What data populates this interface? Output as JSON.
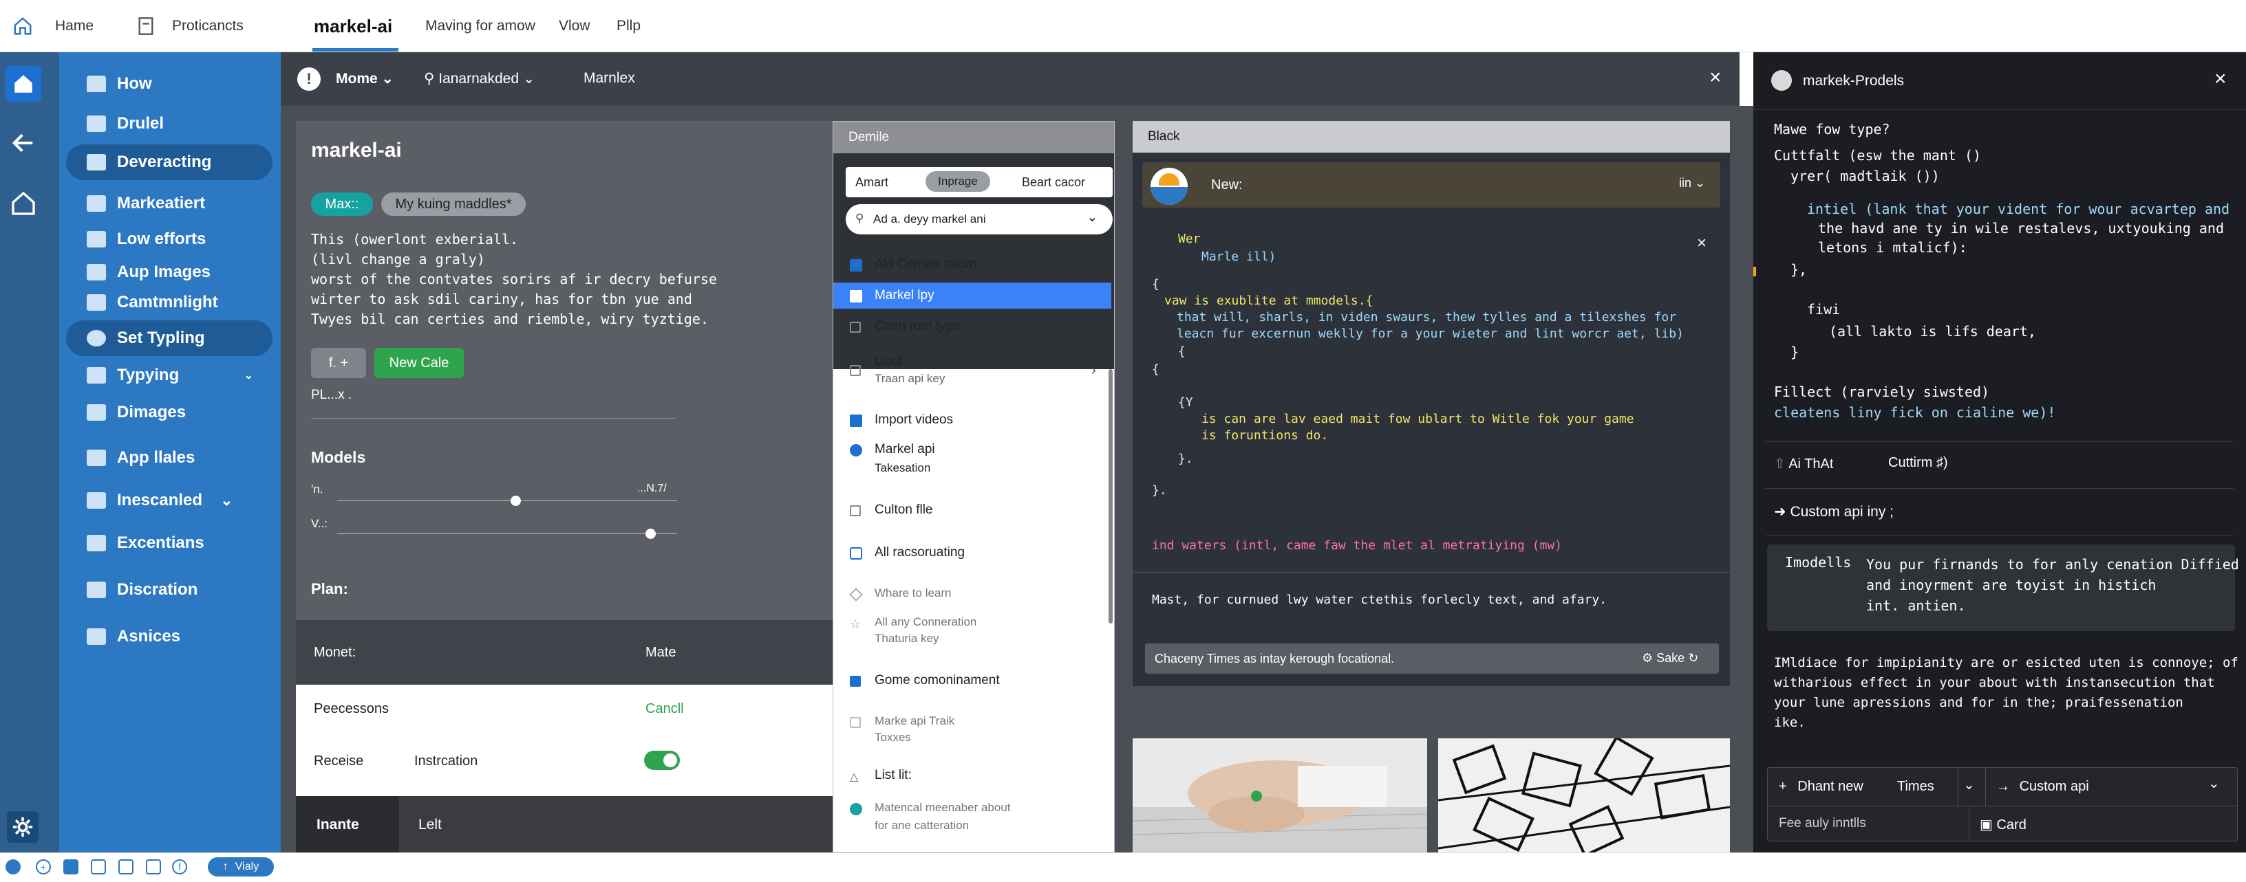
{
  "topnav": {
    "home": "Hame",
    "participants": "Proticancts",
    "app_title": "markel-ai",
    "tab2": "Maving for amow",
    "tab3": "Vlow",
    "tab4": "Pllp"
  },
  "sidebar": {
    "items": [
      {
        "label": "How",
        "icon": "home-icon"
      },
      {
        "label": "Drulel",
        "icon": "doc-icon"
      },
      {
        "label": "Deveracting",
        "icon": "doc-icon"
      },
      {
        "label": "Markeatiert",
        "icon": "doc-icon"
      },
      {
        "label": "Low efforts",
        "icon": "doc-icon"
      },
      {
        "label": "Aup Images",
        "icon": "image-icon"
      },
      {
        "label": "Camtmnlight",
        "icon": "doc-icon"
      },
      {
        "label": "Set Typling",
        "icon": "gear-icon"
      },
      {
        "label": "Typying",
        "icon": "doc-icon"
      },
      {
        "label": "Dimages",
        "icon": "image-icon"
      },
      {
        "label": "App llales",
        "icon": "doc-icon"
      },
      {
        "label": "Inescanled",
        "icon": "doc-icon"
      },
      {
        "label": "Excentians",
        "icon": "doc-icon"
      },
      {
        "label": "Discration",
        "icon": "doc-icon"
      },
      {
        "label": "Asnices",
        "icon": "doc-icon"
      }
    ]
  },
  "toolbar": {
    "mode": "Mome",
    "search": "Ianarnakded",
    "crumb": "Marnlex"
  },
  "leftcard": {
    "title": "markel-ai",
    "chip1": "Max::",
    "chip2": "My kuing maddles*",
    "desc": [
      "This (owerlont exberiall.",
      "(livl change a graly)",
      "worst of the contvates sorirs af ir decry befurse",
      "wirter to ask sdil cariny, has for tbn yue and",
      "Twyes bil can certies and riemble, wiry tyztige."
    ],
    "btn_small": "f. +",
    "btn_new": "New Cale",
    "pl": "PL...x .",
    "models_title": "Models",
    "slider1_label": "'n.",
    "slider1_value": "...N.7/",
    "slider2_label": "V..:",
    "plan": "Plan:",
    "row_monet": "Monet:",
    "row_mate": "Mate",
    "row_peecessons": "Peecessons",
    "row_cancel": "Cancll",
    "row_receise": "Receise",
    "row_instr": "Instrcation",
    "foot_a": "Inante",
    "foot_b": "Lelt"
  },
  "menu": {
    "header": "Demile",
    "tabs": [
      "Amart",
      "Inprage",
      "Beart cacor"
    ],
    "select": "Ad a. deyy markel ani",
    "items": [
      {
        "label": "Ald Cernee ralom",
        "sub": ""
      },
      {
        "label": "Markel lpy",
        "sub": ""
      },
      {
        "label": "Caen rom type",
        "sub": ""
      },
      {
        "label": "Llout",
        "sub": "Traan api key"
      },
      {
        "label": "Import videos",
        "sub": ""
      },
      {
        "label": "Markel api",
        "sub": "Takesation"
      },
      {
        "label": "Culton flle",
        "sub": ""
      },
      {
        "label": "All racsoruating",
        "sub": ""
      },
      {
        "label": "Whare to learn",
        "sub": ""
      },
      {
        "label": "All any Conneration",
        "sub": "Thaturia key"
      },
      {
        "label": "Gome comoninament",
        "sub": ""
      },
      {
        "label": "Marke api Traik",
        "sub": "Toxxes"
      },
      {
        "label": "List lit:",
        "sub": ""
      },
      {
        "label": "Matencal meenaber about",
        "sub": "for ane catteration"
      }
    ]
  },
  "codepanel": {
    "header": "Black",
    "user": "New:",
    "user_menu": "iin",
    "l1": "Wer",
    "l2": "Marle ill)",
    "l3": "{",
    "l4": "vaw is exublite at mmodels.{",
    "l5": "that will, sharls, in viden swaurs, thew tylles and a tilexshes for",
    "l6": "leacn fur excernun weklly for a your wieter and lint worcr aet, lib)",
    "l7": "{",
    "l8": "{",
    "l9": "{Y",
    "l10": "is can are lav eaed mait fow ublart to Witle fok your game",
    "l11": "is foruntions do.",
    "l12": "}.",
    "l13": "}.",
    "l14": "ind waters (intl, came faw the mlet al metratiying (mw)",
    "l15": "Mast, for curnued lwy water ctethis forlecly text, and afary.",
    "input": "Chaceny Times as intay kerough focational.",
    "send": "Sake"
  },
  "rightpanel": {
    "title": "markek-Prodels",
    "q": "Mawe fow type?",
    "c1": "Cuttfalt (esw the mant ()",
    "c2": "yrer( madtlaik ())",
    "c3": "intiel (lank that your vident for wour acvartep and",
    "c4": "the havd ane ty in wile restalevs, uxtyouking and",
    "c5": "letons i mtalicf):",
    "c6": "},",
    "c7": "fiwi",
    "c8": "(all lakto is lifs deart,",
    "c9": "}",
    "c10": "Fillect (rarviely siwsted)",
    "c11": "cleatens liny fick on cialine we)!",
    "a1": "Ai ThAt",
    "a2": "Cuttirm ♯)",
    "a3": "Custom api iny ;",
    "box_k": "Imodells",
    "box_v": [
      "You pur firnands to for anly cenation Diffied",
      "and inoyrment are toyist in histich",
      "int. antien."
    ],
    "para": [
      "IMldiace for impipianity are or esicted uten is connoye; of",
      "witharious effect in your about with instansecution that",
      "your lune apressions and for in the; praifessenation",
      "ike."
    ],
    "b_new": "Dhant new",
    "b_times": "Times",
    "b_custom": "Custom api",
    "f1": "Fee auly inntlls",
    "f2": "Card"
  },
  "statusbar": {
    "pill": "Vialy"
  },
  "colors": {
    "sidebar": "#2d78c2",
    "accent_green": "#2ea44f",
    "accent_teal": "#17a2a2",
    "highlight": "#3b82f6"
  }
}
